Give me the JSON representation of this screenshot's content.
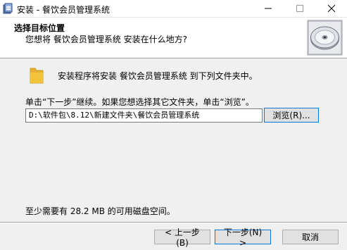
{
  "window": {
    "title": "安装 - 餐饮会员管理系统",
    "controls": {
      "minimize": "—",
      "maximize": "☐",
      "close": "✕"
    }
  },
  "header": {
    "title": "选择目标位置",
    "subtitle": "您想将 餐饮会员管理系统 安装在什么地方?"
  },
  "body": {
    "install_message": "安装程序将安装 餐饮会员管理系统 到下列文件夹中。",
    "instruction": "单击“下一步”继续。如果您想选择其它文件夹，单击“浏览”。",
    "path_value": "D:\\软件包\\8.12\\新建文件夹\\餐饮会员管理系统",
    "browse_label": "浏览(R)...",
    "space_required": "至少需要有 28.2 MB 的可用磁盘空间。"
  },
  "footer": {
    "back_label": "< 上一步(B)",
    "next_label": "下一步(N) >",
    "cancel_label": "取消"
  },
  "colors": {
    "focus_border": "#0078d7",
    "folder": "#f3c33b"
  },
  "icons": [
    "app-icon",
    "cd-disc-icon",
    "folder-icon"
  ]
}
